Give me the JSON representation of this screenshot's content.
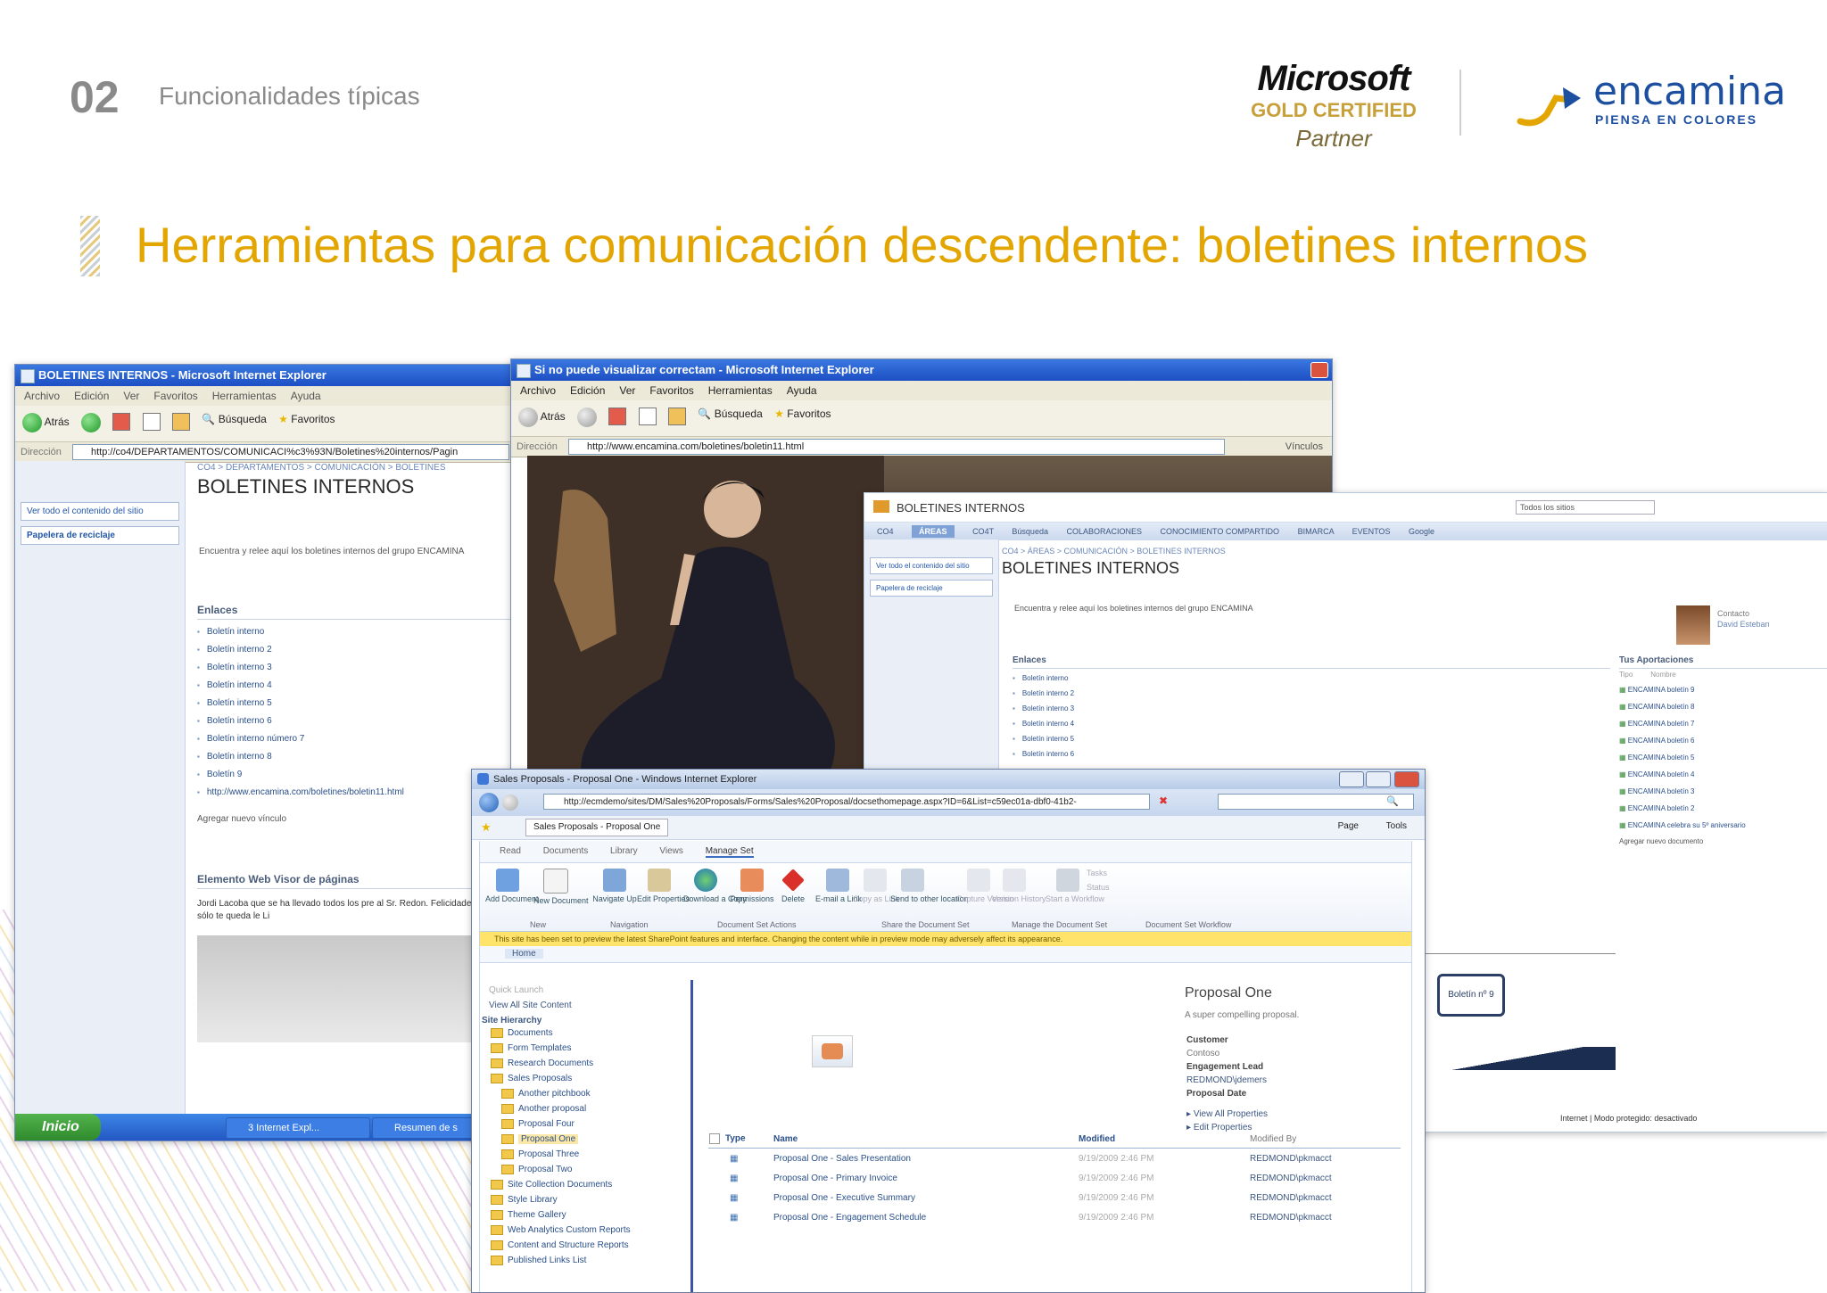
{
  "slide": {
    "section_number": "02",
    "section_title": "Funcionalidades típicas",
    "title": "Herramientas para comunicación descendente: boletines internos",
    "logo_ms": {
      "line1": "Microsoft",
      "line2": "GOLD CERTIFIED",
      "line3": "Partner"
    },
    "logo_encamina": {
      "name": "encamina",
      "tagline": "PIENSA EN COLORES"
    }
  },
  "win1": {
    "title": "BOLETINES INTERNOS - Microsoft Internet Explorer",
    "menu": [
      "Archivo",
      "Edición",
      "Ver",
      "Favoritos",
      "Herramientas",
      "Ayuda"
    ],
    "toolbar": {
      "back": "Atrás",
      "search": "Búsqueda",
      "favorites": "Favoritos"
    },
    "address_label": "Dirección",
    "address": "http://co4/DEPARTAMENTOS/COMUNICACI%c3%93N/Boletines%20internos/Pagin",
    "breadcrumb": "CO4 > DEPARTAMENTOS > COMUNICACIÓN > BOLETINES",
    "page_title": "BOLETINES INTERNOS",
    "left_nav": {
      "view_all": "Ver todo el contenido del sitio",
      "recycle": "Papelera de reciclaje"
    },
    "intro": "Encuentra y relee aquí los boletines internos del grupo ENCAMINA",
    "links_header": "Enlaces",
    "links": [
      "Boletín interno",
      "Boletín interno 2",
      "Boletín interno 3",
      "Boletín interno 4",
      "Boletín interno 5",
      "Boletín interno 6",
      "Boletín interno número 7",
      "Boletín interno 8",
      "Boletín 9",
      "http://www.encamina.com/boletines/boletin11.html"
    ],
    "add_link": "Agregar nuevo vínculo",
    "webpart_header": "Elemento Web Visor de páginas",
    "webpart_text": "Jordi Lacoba que se ha llevado todos los pre al Sr. Redon. Felicidades, sólo te queda le Li",
    "taskbar": {
      "start": "Inicio",
      "task1": "3 Internet Expl...",
      "task2": "Resumen de s"
    }
  },
  "win2": {
    "title": "Si no puede visualizar correctam - Microsoft Internet Explorer",
    "menu": [
      "Archivo",
      "Edición",
      "Ver",
      "Favoritos",
      "Herramientas",
      "Ayuda"
    ],
    "toolbar": {
      "back": "Atrás",
      "search": "Búsqueda",
      "favorites": "Favoritos"
    },
    "address_label": "Dirección",
    "address": "http://www.encamina.com/boletines/boletin11.html",
    "go": "Vínculos"
  },
  "win3": {
    "site_title": "BOLETINES INTERNOS",
    "scope": "Todos los sitios",
    "tabs": [
      "CO4",
      "ÁREAS",
      "CO4T",
      "Búsqueda",
      "COLABORACIONES",
      "CONOCIMIENTO COMPARTIDO",
      "BIMARCA",
      "EVENTOS",
      "Google"
    ],
    "breadcrumb": "CO4 > ÁREAS > COMUNICACIÓN > BOLETINES INTERNOS",
    "page_title": "BOLETINES INTERNOS",
    "left_nav": {
      "view_all": "Ver todo el contenido del sitio",
      "recycle": "Papelera de reciclaje"
    },
    "intro": "Encuentra y relee aquí los boletines internos del grupo ENCAMINA",
    "contact_label": "Contacto",
    "contact_name": "David Esteban",
    "links_header": "Enlaces",
    "links": [
      "Boletín interno",
      "Boletín interno 2",
      "Boletín interno 3",
      "Boletín interno 4",
      "Boletín interno 5",
      "Boletín interno 6"
    ],
    "contrib_header": "Tus Aportaciones",
    "contrib_cols": [
      "Tipo",
      "Nombre"
    ],
    "contrib_items": [
      "ENCAMINA boletín 9",
      "ENCAMINA boletín 8",
      "ENCAMINA boletín 7",
      "ENCAMINA boletín 6",
      "ENCAMINA boletín 5",
      "ENCAMINA boletín 4",
      "ENCAMINA boletín 3",
      "ENCAMINA boletín 2",
      "ENCAMINA celebra su 5º aniversario"
    ],
    "add_doc": "Agregar nuevo documento",
    "boletin_label": "Boletín nº 9",
    "status": "Internet | Modo protegido: desactivado"
  },
  "win4": {
    "title": "Sales Proposals - Proposal One - Windows Internet Explorer",
    "address": "http://ecmdemo/sites/DM/Sales%20Proposals/Forms/Sales%20Proposal/docsethomepage.aspx?ID=6&List=c59ec01a-dbf0-41b2-",
    "tab": "Sales Proposals - Proposal One",
    "cmd": {
      "page": "Page",
      "tools": "Tools"
    },
    "ribbon_tabs": [
      "Read",
      "Documents",
      "Library",
      "Views",
      "Manage Set"
    ],
    "ribbon_buttons": [
      "Add Document",
      "New Document",
      "Navigate Up",
      "Edit Properties",
      "Download a Copy",
      "Permissions",
      "Delete",
      "E-mail a Link",
      "Copy as Link",
      "Send to other location",
      "Capture Version",
      "Version History",
      "Start a Workflow",
      "Tasks",
      "Status"
    ],
    "ribbon_groups": [
      "New",
      "Navigation",
      "Document Set Actions",
      "Share the Document Set",
      "Manage the Document Set",
      "Document Set Workflow"
    ],
    "warning": "This site has been set to preview the latest SharePoint features and interface. Changing the content while in preview mode may adversely affect its appearance.",
    "home": "Home",
    "quick_launch": "Quick Launch",
    "view_all": "View All Site Content",
    "hierarchy_title": "Site Hierarchy",
    "tree": [
      "Documents",
      "Form Templates",
      "Research Documents",
      "Sales Proposals",
      "Another pitchbook",
      "Another proposal",
      "Proposal Four",
      "Proposal One",
      "Proposal Three",
      "Proposal Two",
      "Site Collection Documents",
      "Style Library",
      "Theme Gallery",
      "Web Analytics Custom Reports",
      "Content and Structure Reports",
      "Published Links List"
    ],
    "doc_title": "Proposal One",
    "doc_desc": "A super compelling proposal.",
    "props": [
      {
        "label": "Customer",
        "value": "Contoso"
      },
      {
        "label": "Engagement Lead",
        "value": "REDMOND\\jdemers"
      },
      {
        "label": "Proposal Date",
        "value": ""
      }
    ],
    "view_props": "View All Properties",
    "edit_props": "Edit Properties",
    "table_headers": [
      "Type",
      "Name",
      "Modified",
      "Modified By"
    ],
    "rows": [
      {
        "name": "Proposal One - Sales Presentation",
        "modified": "9/19/2009 2:46 PM",
        "by": "REDMOND\\pkmacct"
      },
      {
        "name": "Proposal One - Primary Invoice",
        "modified": "9/19/2009 2:46 PM",
        "by": "REDMOND\\pkmacct"
      },
      {
        "name": "Proposal One - Executive Summary",
        "modified": "9/19/2009 2:46 PM",
        "by": "REDMOND\\pkmacct"
      },
      {
        "name": "Proposal One - Engagement Schedule",
        "modified": "9/19/2009 2:46 PM",
        "by": "REDMOND\\pkmacct"
      }
    ]
  },
  "colors": {
    "title": "#e3a500",
    "section": "#8a8a8a",
    "xp_blue": "#1d4fc4",
    "sp_link": "#2a4f8a",
    "warning": "#ffe36b"
  }
}
